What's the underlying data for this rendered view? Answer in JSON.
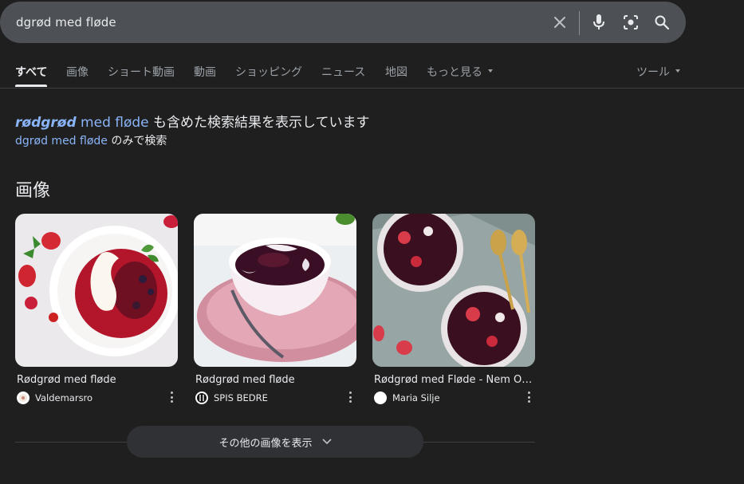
{
  "search": {
    "query": "dgrød med fløde"
  },
  "tabs": [
    {
      "label": "すべて"
    },
    {
      "label": "画像"
    },
    {
      "label": "ショート動画"
    },
    {
      "label": "動画"
    },
    {
      "label": "ショッピング"
    },
    {
      "label": "ニュース"
    },
    {
      "label": "地図"
    },
    {
      "label": "もっと見る"
    }
  ],
  "tools_label": "ツール",
  "spelling": {
    "corrected_bold": "rødgrød",
    "corrected_rest": " med fløde",
    "suffix": " も含めた検索結果を表示しています",
    "original_query": "dgrød med fløde",
    "original_suffix": " のみで検索"
  },
  "images_section": {
    "title": "画像",
    "cards": [
      {
        "title": "Rødgrød med fløde",
        "source": "Valdemarsro"
      },
      {
        "title": "Rødgrød med fløde",
        "source": "SPIS BEDRE"
      },
      {
        "title": "Rødgrød med Fløde - Nem Opskrift",
        "source": "Maria Silje"
      }
    ],
    "more_label": "その他の画像を表示"
  }
}
